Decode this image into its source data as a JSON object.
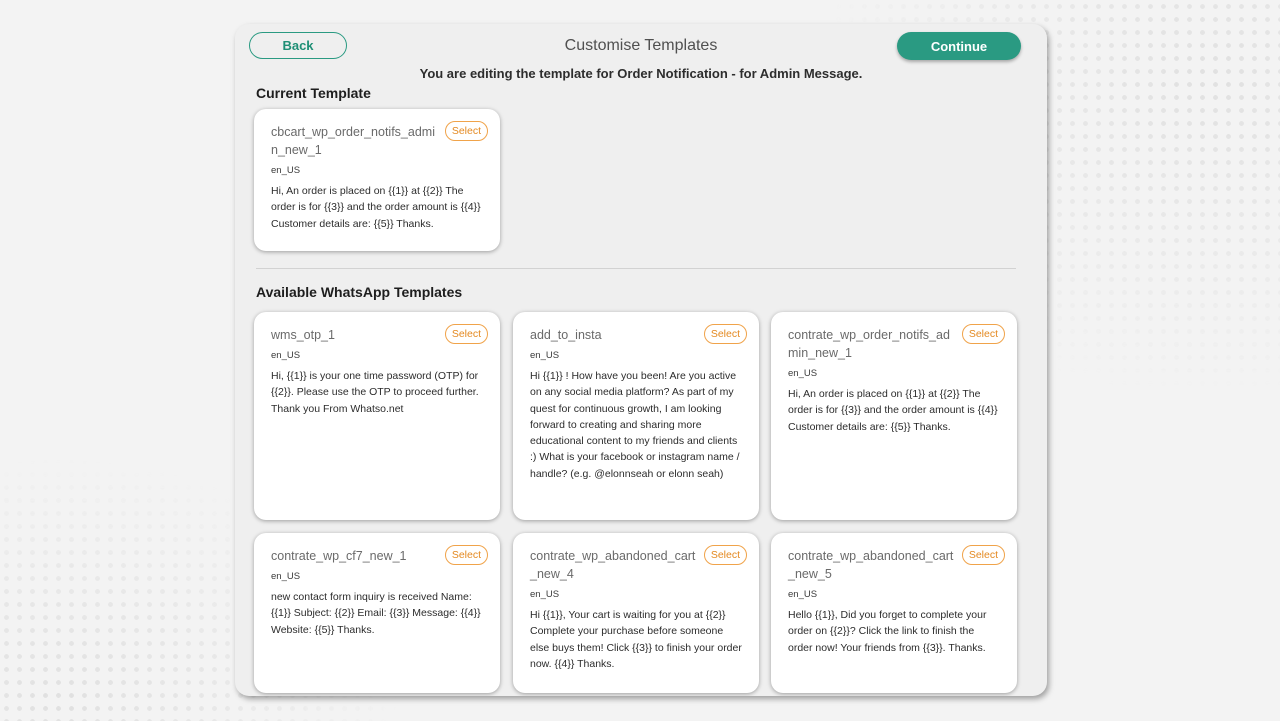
{
  "header": {
    "back_label": "Back",
    "title": "Customise Templates",
    "continue_label": "Continue",
    "subtitle": "You are editing the template for Order Notification - for Admin Message."
  },
  "current_section": {
    "title": "Current Template",
    "template": {
      "name": "cbcart_wp_order_notifs_admin_new_1",
      "lang": "en_US",
      "body": "Hi, An order is placed on {{1}} at {{2}} The order is for {{3}} and the order amount is {{4}} Customer details are: {{5}} Thanks.",
      "select_label": "Select"
    }
  },
  "available_section": {
    "title": "Available WhatsApp Templates",
    "templates": [
      {
        "name": "wms_otp_1",
        "lang": "en_US",
        "body": "Hi, {{1}} is your one time password (OTP) for {{2}}. Please use the OTP to proceed further. Thank you From Whatso.net",
        "select_label": "Select"
      },
      {
        "name": "add_to_insta",
        "lang": "en_US",
        "body": "Hi {{1}} ! How have you been! Are you active on any social media platform? As part of my quest for continuous growth, I am looking forward to creating and sharing more educational content to my friends and clients :) What is your facebook or instagram name / handle? (e.g. @elonnseah or elonn seah)",
        "select_label": "Select"
      },
      {
        "name": "contrate_wp_order_notifs_admin_new_1",
        "lang": "en_US",
        "body": "Hi, An order is placed on {{1}} at {{2}} The order is for {{3}} and the order amount is {{4}} Customer details are: {{5}} Thanks.",
        "select_label": "Select"
      },
      {
        "name": "contrate_wp_cf7_new_1",
        "lang": "en_US",
        "body": "new contact form inquiry is received Name: {{1}} Subject: {{2}} Email: {{3}} Message: {{4}} Website: {{5}} Thanks.",
        "select_label": "Select"
      },
      {
        "name": "contrate_wp_abandoned_cart_new_4",
        "lang": "en_US",
        "body": "Hi {{1}}, Your cart is waiting for you at {{2}} Complete your purchase before someone else buys them! Click {{3}} to finish your order now. {{4}} Thanks.",
        "select_label": "Select"
      },
      {
        "name": "contrate_wp_abandoned_cart_new_5",
        "lang": "en_US",
        "body": "Hello {{1}}, Did you forget to complete your order on {{2}}? Click the link to finish the order now! Your friends from {{3}}. Thanks.",
        "select_label": "Select"
      }
    ]
  }
}
